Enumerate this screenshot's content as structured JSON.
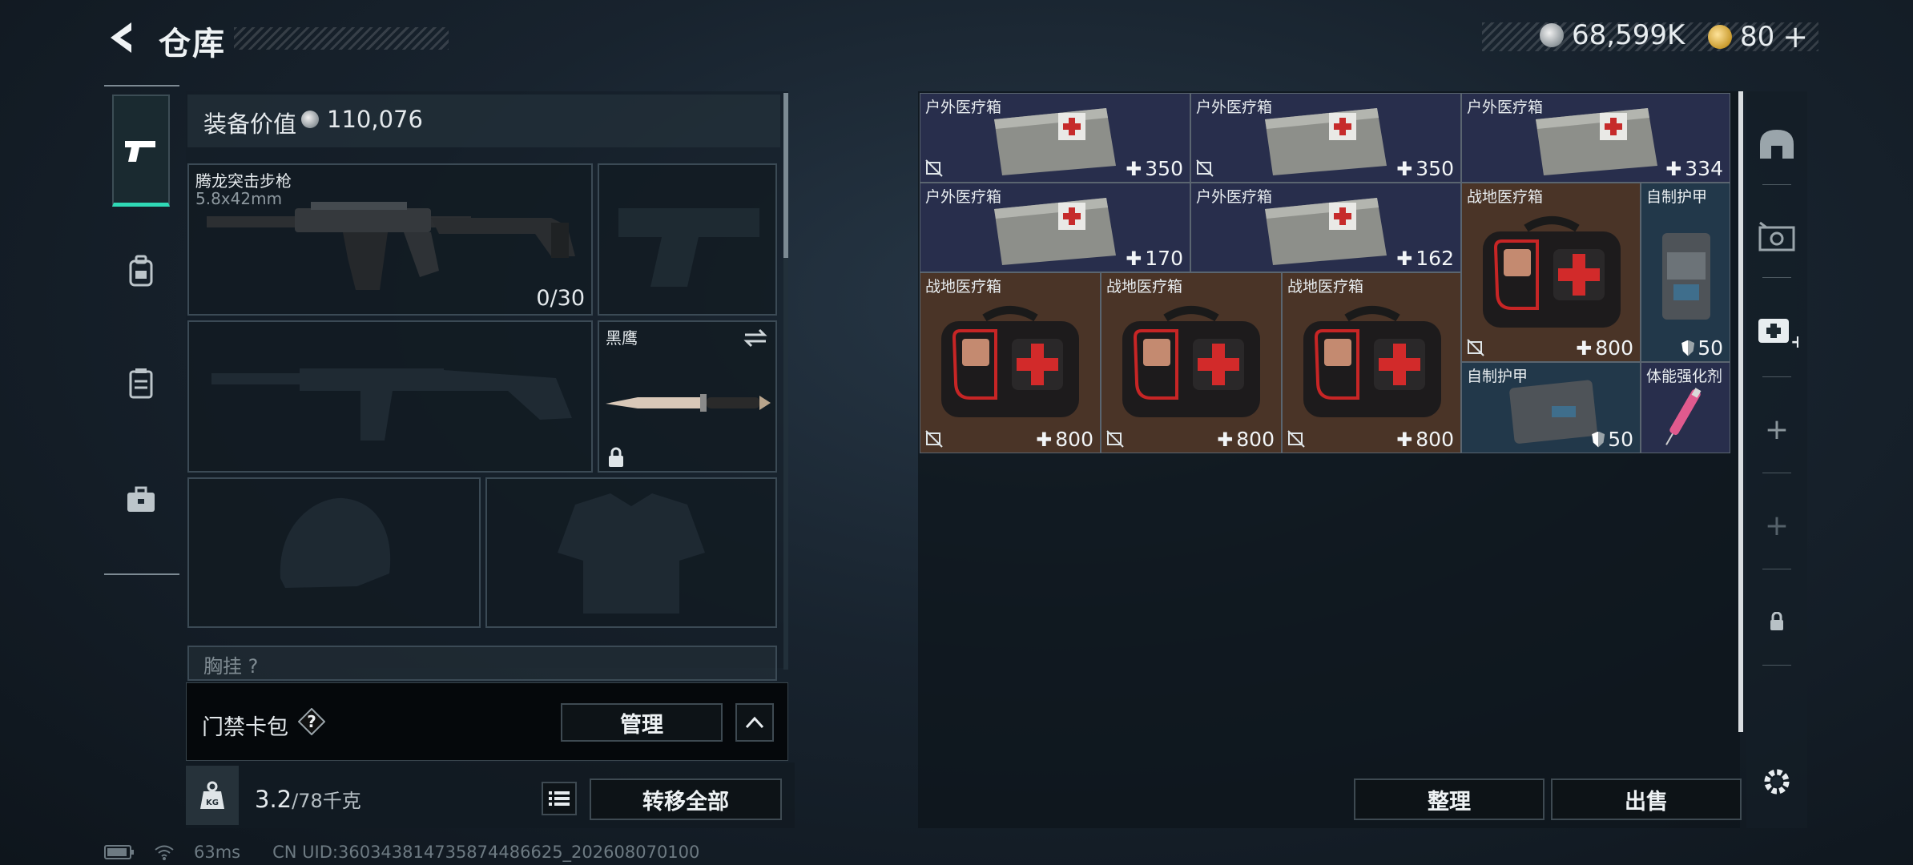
{
  "header": {
    "title": "仓库",
    "currency_silver": "68,599K",
    "currency_gold": "80"
  },
  "equipment": {
    "value_label": "装备价值",
    "value": "110,076",
    "primary_weapon": {
      "name": "腾龙突击步枪",
      "caliber": "5.8x42mm",
      "ammo": "0/30"
    },
    "melee": {
      "name": "黑鹰"
    },
    "partial_slot_label": "胸挂 ?"
  },
  "keycard": {
    "label": "门禁卡包",
    "help": "?",
    "manage_label": "管理"
  },
  "weight": {
    "current": "3.2",
    "max": "/78千克"
  },
  "actions": {
    "transfer_all": "转移全部",
    "sort": "整理",
    "sell": "出售"
  },
  "storage": {
    "items": [
      {
        "name": "户外医疗箱",
        "value": "350",
        "kind": "plus",
        "color": "navy"
      },
      {
        "name": "户外医疗箱",
        "value": "350",
        "kind": "plus",
        "color": "navy"
      },
      {
        "name": "户外医疗箱",
        "value": "334",
        "kind": "plus",
        "color": "navy"
      },
      {
        "name": "户外医疗箱",
        "value": "170",
        "kind": "plus",
        "color": "navy"
      },
      {
        "name": "户外医疗箱",
        "value": "162",
        "kind": "plus",
        "color": "navy"
      },
      {
        "name": "战地医疗箱",
        "value": "800",
        "kind": "plus",
        "color": "brown"
      },
      {
        "name": "自制护甲",
        "value": "50",
        "kind": "shield",
        "color": "teal"
      },
      {
        "name": "战地医疗箱",
        "value": "800",
        "kind": "plus",
        "color": "brown"
      },
      {
        "name": "战地医疗箱",
        "value": "800",
        "kind": "plus",
        "color": "brown"
      },
      {
        "name": "战地医疗箱",
        "value": "800",
        "kind": "plus",
        "color": "brown"
      },
      {
        "name": "自制护甲",
        "value": "50",
        "kind": "shield",
        "color": "teal"
      },
      {
        "name": "体能强化剂",
        "value": "",
        "kind": "none",
        "color": "navy"
      }
    ]
  },
  "footer": {
    "ping": "63ms",
    "uid": "CN UID:360343814735874486625_202608070100"
  },
  "colors": {
    "accent": "#2fd9b6",
    "navy": "#282e4c",
    "brown": "#4a3427",
    "teal": "#22384a"
  }
}
